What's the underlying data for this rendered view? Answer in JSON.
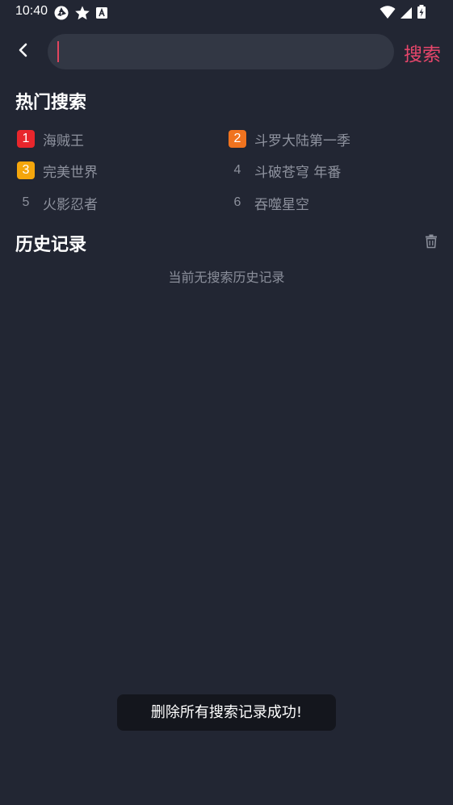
{
  "status_bar": {
    "time": "10:40",
    "left_icons": [
      "shutter-icon",
      "star-icon",
      "text-a-icon"
    ],
    "right_icons": [
      "wifi-icon",
      "signal-icon",
      "battery-charging-icon"
    ]
  },
  "header": {
    "back_icon": "chevron-left-icon",
    "search_value": "",
    "search_placeholder": "",
    "search_button_label": "搜索"
  },
  "hot_search": {
    "title": "热门搜索",
    "items": [
      {
        "rank": "1",
        "label": "海贼王",
        "badge_color": "#e8262c"
      },
      {
        "rank": "2",
        "label": "斗罗大陆第一季",
        "badge_color": "#f0731f"
      },
      {
        "rank": "3",
        "label": "完美世界",
        "badge_color": "#f5a60c"
      },
      {
        "rank": "4",
        "label": "斗破苍穹 年番",
        "badge_color": ""
      },
      {
        "rank": "5",
        "label": "火影忍者",
        "badge_color": ""
      },
      {
        "rank": "6",
        "label": "吞噬星空",
        "badge_color": ""
      }
    ]
  },
  "history": {
    "title": "历史记录",
    "clear_icon": "trash-icon",
    "empty_text": "当前无搜索历史记录"
  },
  "toast": {
    "message": "删除所有搜索记录成功!"
  },
  "colors": {
    "background": "#222633",
    "accent": "#e7466b",
    "search_box": "#323744"
  }
}
